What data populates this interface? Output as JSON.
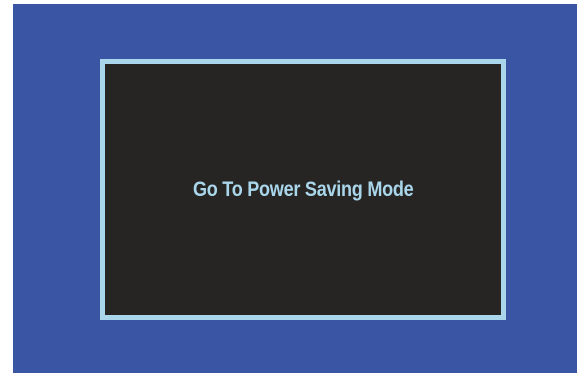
{
  "osd": {
    "message": "Go To Power Saving Mode"
  },
  "colors": {
    "background": "#3a55a4",
    "dialog_fill": "#272523",
    "accent": "#a9d6ea"
  }
}
